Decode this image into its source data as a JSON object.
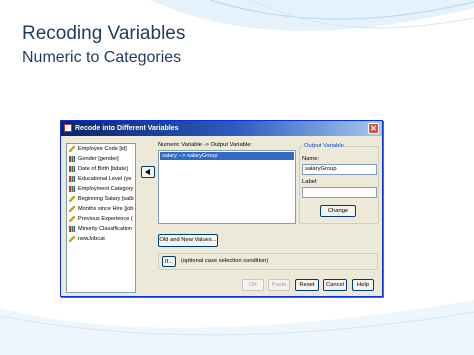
{
  "slide": {
    "title": "Recoding Variables",
    "subtitle": "Numeric to Categories"
  },
  "dialog": {
    "title": "Recode into Different Variables",
    "close_glyph": "✕",
    "variables": [
      {
        "label": "Employee Code [id]",
        "icon": "ruler-icon"
      },
      {
        "label": "Gender [gender]",
        "icon": "bar-chart-icon"
      },
      {
        "label": "Date of Birth [bdate]",
        "icon": "bar-chart-icon"
      },
      {
        "label": "Educational Level (ye",
        "icon": "bar-chart-icon"
      },
      {
        "label": "Employment Category",
        "icon": "bar-chart-icon"
      },
      {
        "label": "Beginning Salary [salb",
        "icon": "ruler-icon"
      },
      {
        "label": "Months since Hire [job",
        "icon": "ruler-icon"
      },
      {
        "label": "Previous Experience (",
        "icon": "ruler-icon"
      },
      {
        "label": "Minority Classification",
        "icon": "bar-chart-icon"
      },
      {
        "label": "newJobcat",
        "icon": "ruler-icon"
      }
    ],
    "numeric_output_label": "Numeric Variable -> Output Variable:",
    "numeric_output_rows": [
      "salary --> salaryGroup"
    ],
    "output_variable": {
      "legend": "Output Variable",
      "name_label": "Name:",
      "name_value": "salaryGroup",
      "label_label": "Label:",
      "label_value": "",
      "change_button": "Change"
    },
    "old_new_button": "Old and New Values...",
    "if_button": "If...",
    "condition_text": "(optional case selection condition)",
    "buttons": {
      "ok": "OK",
      "paste": "Paste",
      "reset": "Reset",
      "cancel": "Cancel",
      "help": "Help"
    }
  },
  "colors": {
    "title_text": "#1f3b5e",
    "accent_blue": "#316ac5",
    "dialog_face": "#ece9d8"
  }
}
